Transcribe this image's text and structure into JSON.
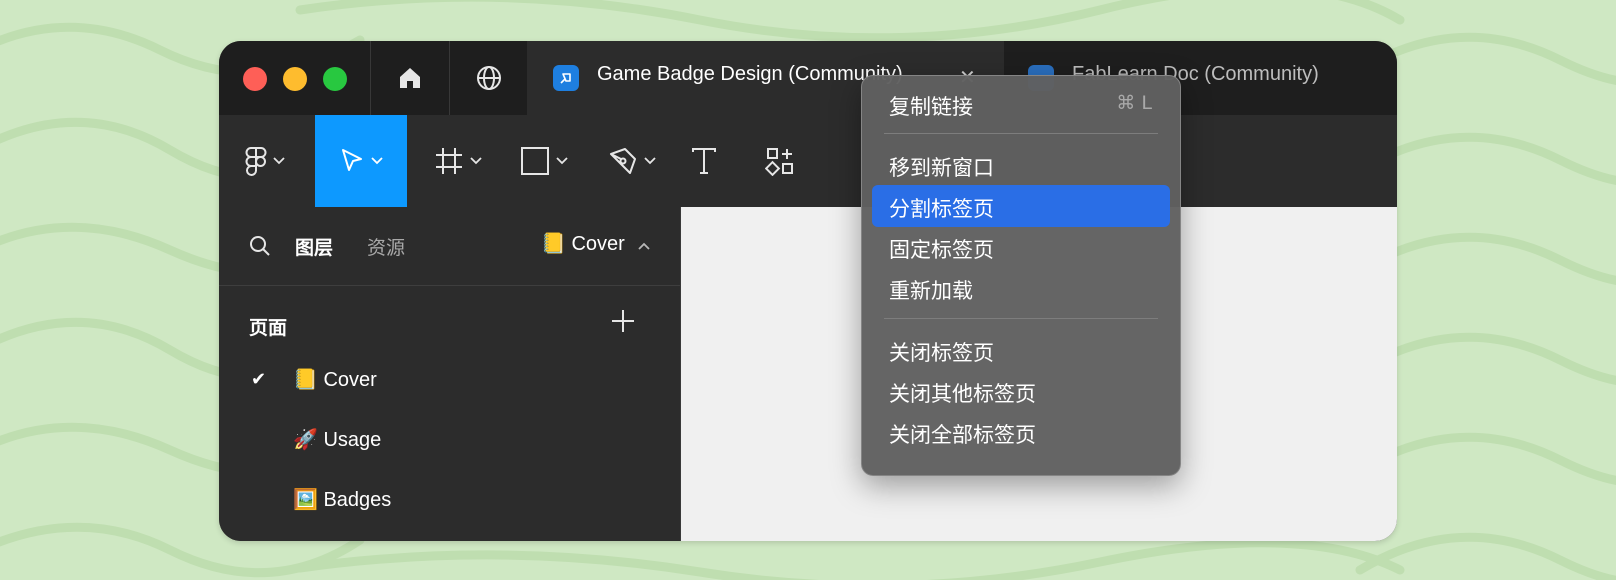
{
  "window": {
    "tabs": [
      {
        "title": "Game Badge Design (Community)",
        "close_glyph": "✕"
      },
      {
        "title": "FabLearn Doc (Community)"
      }
    ]
  },
  "toolbar": {
    "tools": [
      "figma-menu",
      "move",
      "frame",
      "rectangle",
      "pen",
      "text",
      "resources"
    ],
    "active_tool": "move",
    "accent": "#0d99ff"
  },
  "sidebar": {
    "tab_layers": "图层",
    "tab_assets": "资源",
    "current_page": "📒 Cover",
    "pages_title": "页面",
    "pages": [
      {
        "label": "📒 Cover",
        "selected": true
      },
      {
        "label": "🚀 Usage",
        "selected": false
      },
      {
        "label": "🖼️ Badges",
        "selected": false
      }
    ]
  },
  "context_menu": {
    "copy_link": "复制链接",
    "copy_link_shortcut": "⌘ L",
    "move_to_new_window": "移到新窗口",
    "split_tab": "分割标签页",
    "pin_tab": "固定标签页",
    "reload": "重新加载",
    "close_tab": "关闭标签页",
    "close_other_tabs": "关闭其他标签页",
    "close_all_tabs": "关闭全部标签页",
    "highlight_color": "#2a6ee6"
  },
  "colors": {
    "background": "#cfe8c3",
    "titlebar": "#1e1e1e",
    "panel": "#2c2c2c",
    "canvas": "#f0f0f0"
  }
}
